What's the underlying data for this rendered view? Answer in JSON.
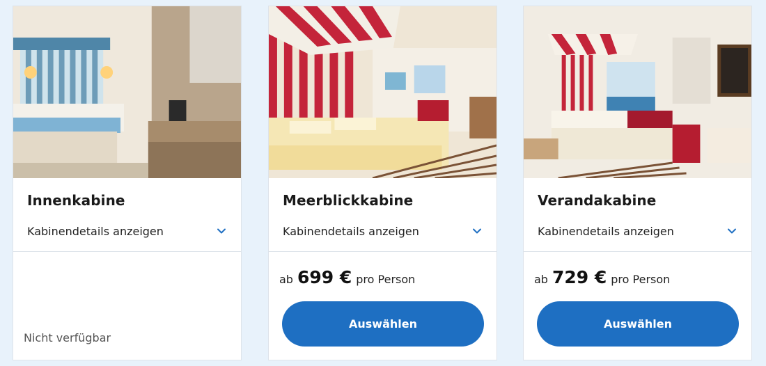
{
  "colors": {
    "accent": "#1e6fc2",
    "background": "#e8f2fb"
  },
  "cabins": [
    {
      "title": "Innenkabine",
      "details_label": "Kabinendetails anzeigen",
      "details_icon": "chevron-down-icon",
      "status": "Nicht verfügbar"
    },
    {
      "title": "Meerblickkabine",
      "details_label": "Kabinendetails anzeigen",
      "details_icon": "chevron-down-icon",
      "price_prefix": "ab",
      "price": "699 €",
      "price_suffix": "pro Person",
      "button_label": "Auswählen"
    },
    {
      "title": "Verandakabine",
      "details_label": "Kabinendetails anzeigen",
      "details_icon": "chevron-down-icon",
      "price_prefix": "ab",
      "price": "729 €",
      "price_suffix": "pro Person",
      "button_label": "Auswählen"
    }
  ]
}
